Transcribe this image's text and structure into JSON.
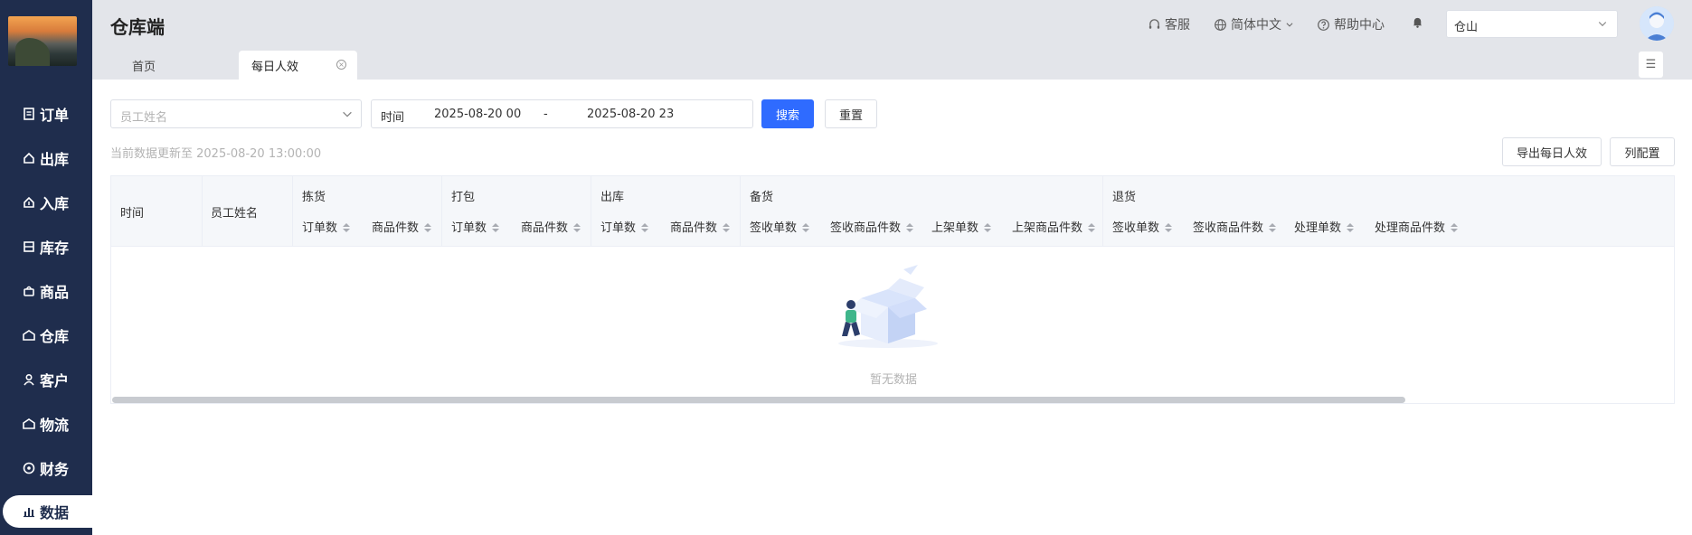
{
  "app": {
    "title": "仓库端"
  },
  "sidebar": {
    "items": [
      {
        "label": "订单",
        "icon": "document-icon"
      },
      {
        "label": "出库",
        "icon": "outbound-icon"
      },
      {
        "label": "入库",
        "icon": "inbound-icon"
      },
      {
        "label": "库存",
        "icon": "inventory-icon"
      },
      {
        "label": "商品",
        "icon": "bag-icon"
      },
      {
        "label": "仓库",
        "icon": "warehouse-icon"
      },
      {
        "label": "客户",
        "icon": "user-icon"
      },
      {
        "label": "物流",
        "icon": "logistics-icon"
      },
      {
        "label": "财务",
        "icon": "finance-icon"
      },
      {
        "label": "数据",
        "icon": "chart-icon",
        "active": true
      }
    ]
  },
  "header": {
    "customer_service": "客服",
    "language": "简体中文",
    "help_center": "帮助中心",
    "warehouse_select": "仓山"
  },
  "tabs": [
    {
      "label": "首页"
    },
    {
      "label": "每日人效",
      "active": true
    }
  ],
  "filters": {
    "employee_placeholder": "员工姓名",
    "time_label": "时间",
    "start_time": "2025-08-20 00",
    "separator": "-",
    "end_time": "2025-08-20 23",
    "search_label": "搜索",
    "reset_label": "重置"
  },
  "update_note": "当前数据更新至 2025-08-20 13:00:00",
  "actions": {
    "export_label": "导出每日人效",
    "columns_label": "列配置"
  },
  "table": {
    "fixed_columns": [
      "时间",
      "员工姓名"
    ],
    "groups": [
      {
        "label": "拣货",
        "columns": [
          "订单数",
          "商品件数"
        ]
      },
      {
        "label": "打包",
        "columns": [
          "订单数",
          "商品件数"
        ]
      },
      {
        "label": "出库",
        "columns": [
          "订单数",
          "商品件数"
        ]
      },
      {
        "label": "备货",
        "columns": [
          "签收单数",
          "签收商品件数",
          "上架单数",
          "上架商品件数"
        ]
      },
      {
        "label": "退货",
        "columns": [
          "签收单数",
          "签收商品件数",
          "处理单数",
          "处理商品件数"
        ]
      }
    ],
    "empty_text": "暂无数据"
  },
  "colors": {
    "sidebar_bg": "#1f2d4d",
    "primary": "#2f6bff",
    "header_bg": "#e3e5ea"
  }
}
